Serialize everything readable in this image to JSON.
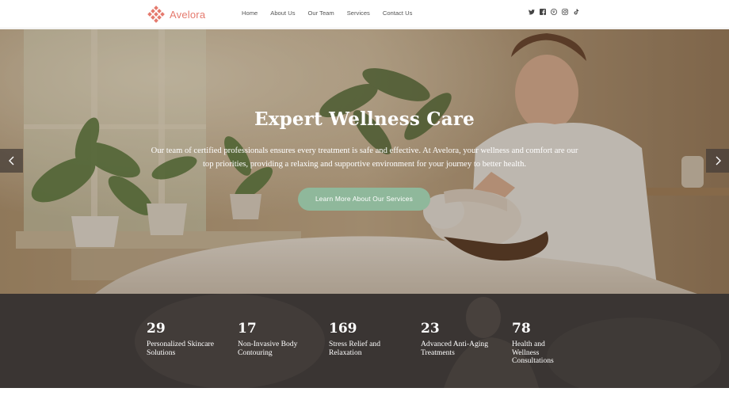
{
  "brand": {
    "name": "Avelora",
    "color": "#e57a6e"
  },
  "nav": {
    "items": [
      {
        "label": "Home"
      },
      {
        "label": "About Us"
      },
      {
        "label": "Our Team"
      },
      {
        "label": "Services"
      },
      {
        "label": "Contact Us"
      }
    ]
  },
  "social": {
    "icons": [
      "twitter-icon",
      "facebook-icon",
      "pinterest-icon",
      "instagram-icon",
      "tiktok-icon"
    ]
  },
  "hero": {
    "title": "Expert Wellness Care",
    "text": "Our team of certified professionals ensures every treatment is safe and effective. At Avelora, your wellness and comfort are our top priorities, providing a relaxing and supportive environment for your journey to better health.",
    "button_label": "Learn More About Our Services",
    "button_color": "#8fb89b",
    "prev_icon": "chevron-left-icon",
    "next_icon": "chevron-right-icon"
  },
  "stats": {
    "background": "#3a3533",
    "items": [
      {
        "number": "29",
        "label": "Personalized Skincare Solutions"
      },
      {
        "number": "17",
        "label": "Non-Invasive Body Contouring"
      },
      {
        "number": "169",
        "label": "Stress Relief and Relaxation"
      },
      {
        "number": "23",
        "label": "Advanced Anti-Aging Treatments"
      },
      {
        "number": "78",
        "label": "Health and Wellness Consultations"
      }
    ]
  }
}
